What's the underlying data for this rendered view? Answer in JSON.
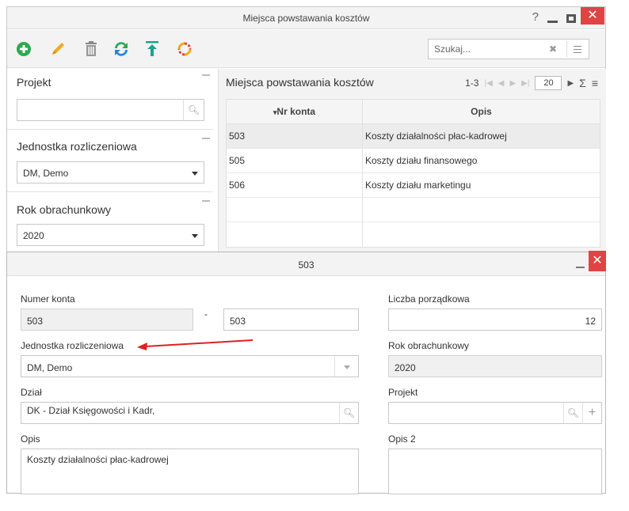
{
  "main_window": {
    "title": "Miejsca powstawania kosztów",
    "help_label": "?",
    "close_label": "✕",
    "toolbar_search_placeholder": "Szukaj..."
  },
  "filters": [
    {
      "label": "Projekt",
      "value": ""
    },
    {
      "label": "Jednostka rozliczeniowa",
      "value": "DM, Demo"
    },
    {
      "label": "Rok obrachunkowy",
      "value": "2020"
    }
  ],
  "grid": {
    "title": "Miejsca powstawania kosztów",
    "pager_range": "1-3",
    "page_size": "20",
    "sigma": "Σ",
    "columns": [
      "Nr konta",
      "Opis"
    ],
    "rows": [
      {
        "nr": "503",
        "opis": "Koszty działalności płac-kadrowej"
      },
      {
        "nr": "505",
        "opis": "Koszty działu finansowego"
      },
      {
        "nr": "506",
        "opis": "Koszty działu marketingu"
      }
    ]
  },
  "detail": {
    "title": "503",
    "close_label": "✕",
    "numer_konta_label": "Numer konta",
    "numer_konta_prefix": "503",
    "dash": "-",
    "numer_konta_value": "503",
    "liczba_label": "Liczba porządkowa",
    "liczba_value": "12",
    "jednostka_label": "Jednostka rozliczeniowa",
    "jednostka_value": "DM, Demo",
    "rok_label": "Rok obrachunkowy",
    "rok_value": "2020",
    "dzial_label": "Dział",
    "dzial_value": "DK - Dział Księgowości i Kadr,",
    "projekt_label": "Projekt",
    "projekt_value": "",
    "opis_label": "Opis",
    "opis_value": "Koszty działalności płac-kadrowej",
    "opis2_label": "Opis 2",
    "opis2_value": ""
  },
  "colors": {
    "accent_green": "#2fa84f",
    "accent_orange": "#f5a623",
    "accent_blue": "#1e88e5",
    "close_red": "#e04343",
    "annotation_arrow": "#e02020"
  }
}
